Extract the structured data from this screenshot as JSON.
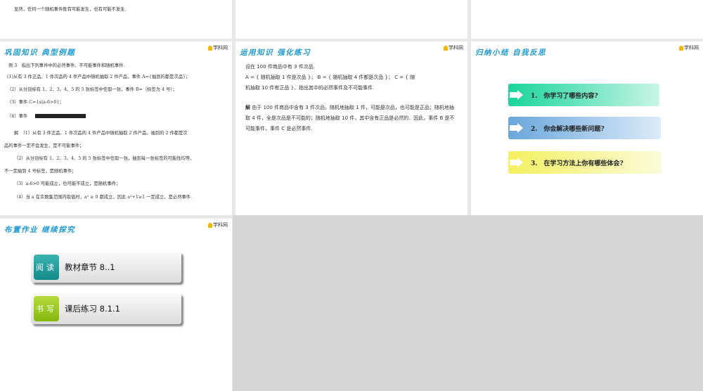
{
  "slide1": {
    "line": "显然，任何一个随机事件既有可能发生，也有可能不发生．"
  },
  "logo": "学科网",
  "slide4": {
    "title": "巩固知识 典型例题",
    "lines": [
      "例 3　指出下列事件中的必然事件、不可能事件和随机事件.",
      "(1)从有 3 件正品、1 件次品的 4 件产品中随机抽取 2 件产品，事件 A={抽到的都是次品}；",
      "（2）从分别标有 1、2、3、4、5 的 5 张标签中任取一张，事件 B=｛标签为 4 号｝；",
      "（3）事件 C={a|a-6>0}；",
      "（4）事件"
    ],
    "solution": [
      "解　（1）从有 3 件正品、1 件次品的 4 件产品中随机抽取 2 件产品，抽到的 2 件都是次",
      "品的事件一定不会发生，是不可能事件；",
      "（2）从分别标有 1、2、3、4、5 的 5 张标签中任取一张，抽到每一张标签的可能性均等，",
      "不一定抽到 4 号标签，是随机事件；",
      "（3）a-6>0 可能成立，也可能不成立，是随机事件；",
      "（4）当 a 在实数集范围内取值时，a² ≥ 0 都成立，因此 a²+1≥1 一定成立，是必然事件."
    ]
  },
  "slide5": {
    "title": "运用知识 强化练习",
    "problem": [
      "设在 100 件商品中有 3 件次品.",
      "A = { 随机抽取 1 件是次品 }； B = { 随机抽取 4 件都是次品 }； C = { 随",
      "机抽取 10 件有正品 }．指出其中的必然事件及不可能事件."
    ],
    "solution_label": "解",
    "solution": " 由于 100 件商品中含有 3 件次品，随机地抽取 1 件，可能是次品，也可能是正品；随机地抽取 4 件，全是次品是不可能的；随机地抽取 10 件，其中含有正品是必然的．因此，事件 B 是不可能事件，事件 C 是必然事件."
  },
  "slide6": {
    "title": "归纳小结 自我反思",
    "items": [
      "1.　你学习了哪些内容?",
      "2.　你会解决哪些新问题?",
      "3.　在学习方法上你有哪些体会?"
    ]
  },
  "slide7": {
    "title": "布置作业 继续探究",
    "cards": [
      {
        "badge": "阅读",
        "text": "教材章节 8..1"
      },
      {
        "badge": "书写",
        "text": "课后练习 8.1.1"
      }
    ]
  }
}
